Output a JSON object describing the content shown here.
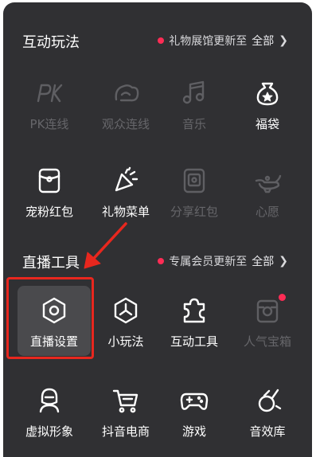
{
  "sections": [
    {
      "title": "互动玩法",
      "notice": "礼物展馆更新至",
      "all": "全部",
      "items": [
        {
          "label": "PK连线",
          "icon": "pk-icon",
          "enabled": false
        },
        {
          "label": "观众连线",
          "icon": "audience-link-icon",
          "enabled": false
        },
        {
          "label": "音乐",
          "icon": "music-note-icon",
          "enabled": false
        },
        {
          "label": "福袋",
          "icon": "lucky-bag-icon",
          "enabled": true
        },
        {
          "label": "宠粉红包",
          "icon": "red-packet-icon",
          "enabled": true
        },
        {
          "label": "礼物菜单",
          "icon": "party-popper-icon",
          "enabled": true
        },
        {
          "label": "分享红包",
          "icon": "share-red-packet-icon",
          "enabled": false
        },
        {
          "label": "心愿",
          "icon": "magic-lamp-icon",
          "enabled": false
        }
      ]
    },
    {
      "title": "直播工具",
      "notice": "专属会员更新至",
      "all": "全部",
      "items": [
        {
          "label": "直播设置",
          "icon": "settings-hexagon-icon",
          "enabled": true,
          "highlighted": true
        },
        {
          "label": "小玩法",
          "icon": "mini-game-icon",
          "enabled": true
        },
        {
          "label": "互动工具",
          "icon": "puzzle-icon",
          "enabled": true
        },
        {
          "label": "人气宝箱",
          "icon": "treasure-box-icon",
          "enabled": false,
          "badge": true
        },
        {
          "label": "虚拟形象",
          "icon": "avatar-icon",
          "enabled": true
        },
        {
          "label": "抖音电商",
          "icon": "shopping-cart-icon",
          "enabled": true
        },
        {
          "label": "游戏",
          "icon": "gamepad-icon",
          "enabled": true
        },
        {
          "label": "音效库",
          "icon": "sound-effects-icon",
          "enabled": true
        }
      ]
    }
  ],
  "colors": {
    "panel": "#303033",
    "accent_dot": "#fe2c55",
    "annotation": "#e8271e",
    "enabled_text": "#ffffff",
    "disabled_text": "#66666a"
  }
}
